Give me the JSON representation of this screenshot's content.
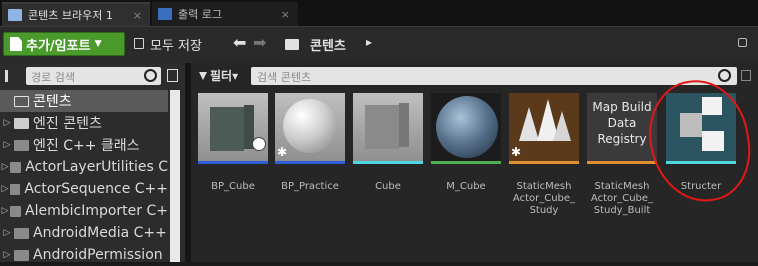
{
  "tabs": [
    {
      "label": "콘텐츠 브라우저 1",
      "close": "×"
    },
    {
      "label": "출력 로그",
      "close": "×"
    }
  ],
  "toolbar": {
    "add_import": "추가/임포트",
    "save_all": "모두 저장",
    "path_root": "콘텐츠",
    "path_sep": "▸"
  },
  "sidebar": {
    "search_placeholder": "경로 검색",
    "tree": [
      {
        "label": "콘텐츠",
        "selected": true
      },
      {
        "label": "엔진 콘텐츠"
      },
      {
        "label": "엔진 C++ 클래스"
      },
      {
        "label": "ActorLayerUtilities C"
      },
      {
        "label": "ActorSequence C++"
      },
      {
        "label": "AlembicImporter C+"
      },
      {
        "label": "AndroidMedia C++"
      },
      {
        "label": "AndroidPermission"
      }
    ]
  },
  "main": {
    "filter_label": "필터▾",
    "search_placeholder": "검색 콘텐츠"
  },
  "assets": [
    {
      "label": "BP_Cube",
      "bar": "#2c5fd8"
    },
    {
      "label": "BP_Practice",
      "bar": "#2c5fd8"
    },
    {
      "label": "Cube",
      "bar": "#4ed7e0"
    },
    {
      "label": "M_Cube",
      "bar": "#4caf50"
    },
    {
      "label": "StaticMesh Actor_Cube_ Study",
      "bar": "#e09030"
    },
    {
      "label": "StaticMesh Actor_Cube_ Study_Built",
      "bar": "#e09030",
      "thumb_text": "Map Build Data Registry"
    },
    {
      "label": "Structer",
      "bar": "#4ed7e0"
    }
  ],
  "icons": [
    "content-browser-tab-icon",
    "output-log-tab-icon",
    "save-icon",
    "back-arrow-icon",
    "forward-arrow-icon",
    "folder-icon",
    "lock-icon",
    "search-icon",
    "settings-icon",
    "filter-icon",
    "sphere-icon"
  ]
}
